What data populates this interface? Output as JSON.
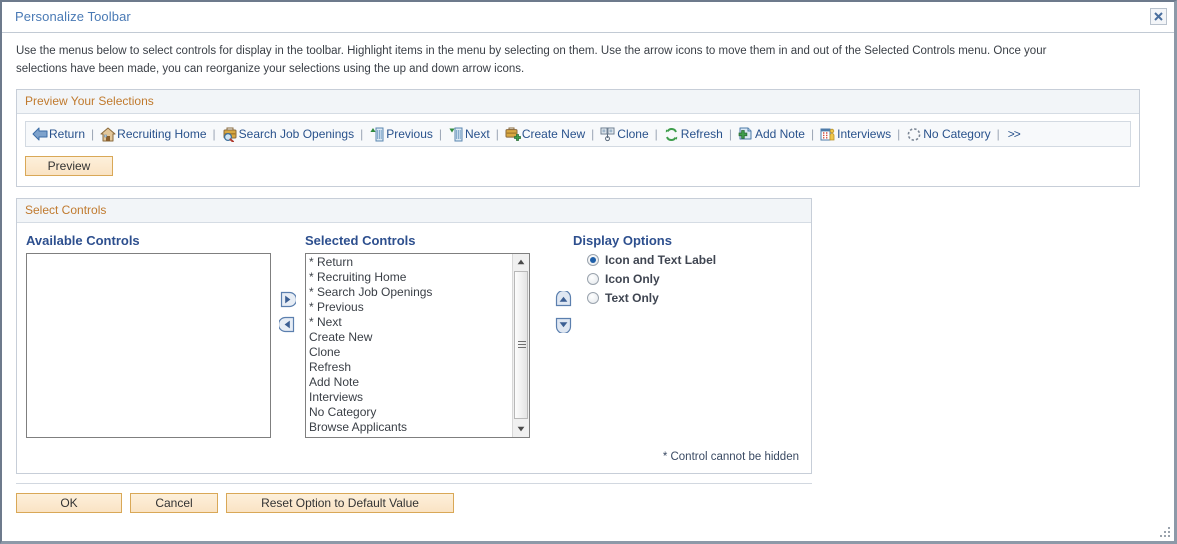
{
  "window": {
    "title": "Personalize Toolbar",
    "close_icon": "close-icon",
    "resize_grip_icon": "resize-grip-icon"
  },
  "instructions": "Use the menus below to select controls for display in the toolbar. Highlight items in the menu by selecting on them. Use the arrow icons to move them in and out of the Selected Controls menu. Once your selections have been made, you can reorganize your selections using the up and down arrow icons.",
  "preview_group": {
    "header": "Preview Your Selections",
    "separator": "|",
    "more_label": ">>",
    "toolbar_items": [
      {
        "label": "Return",
        "icon": "back-arrow-icon"
      },
      {
        "label": "Recruiting Home",
        "icon": "home-icon"
      },
      {
        "label": "Search Job Openings",
        "icon": "briefcase-search-icon"
      },
      {
        "label": "Previous",
        "icon": "previous-icon"
      },
      {
        "label": "Next",
        "icon": "next-icon"
      },
      {
        "label": "Create New",
        "icon": "create-new-icon"
      },
      {
        "label": "Clone",
        "icon": "clone-icon"
      },
      {
        "label": "Refresh",
        "icon": "refresh-icon"
      },
      {
        "label": "Add Note",
        "icon": "add-note-icon"
      },
      {
        "label": "Interviews",
        "icon": "interviews-icon"
      },
      {
        "label": "No Category",
        "icon": "no-category-icon"
      }
    ],
    "preview_button": "Preview"
  },
  "select_group": {
    "header": "Select Controls",
    "available": {
      "label": "Available Controls",
      "items": []
    },
    "selected": {
      "label": "Selected Controls",
      "items": [
        "* Return",
        "* Recruiting Home",
        "* Search Job Openings",
        "* Previous",
        "* Next",
        "Create New",
        "Clone",
        "Refresh",
        "Add Note",
        "Interviews",
        "No Category",
        "Browse Applicants"
      ]
    },
    "transfer": {
      "move_right_icon": "arrow-right-icon",
      "move_left_icon": "arrow-left-icon"
    },
    "reorder": {
      "move_up_icon": "arrow-up-icon",
      "move_down_icon": "arrow-down-icon"
    },
    "display_options": {
      "label": "Display Options",
      "selected": "Icon and Text Label",
      "options": [
        {
          "label": "Icon and Text Label",
          "checked": true
        },
        {
          "label": "Icon Only",
          "checked": false
        },
        {
          "label": "Text Only",
          "checked": false
        }
      ]
    },
    "note": "* Control cannot be hidden"
  },
  "footer": {
    "ok": "OK",
    "cancel": "Cancel",
    "reset": "Reset Option to Default Value"
  },
  "colors": {
    "title_blue": "#4a7ab5",
    "group_header_orange": "#c07a2e",
    "link_blue": "#29528c",
    "heading_blue": "#2d4f8e",
    "button_face": "#fae3c4",
    "button_border": "#d9a857",
    "radio_selected": "#1f5fa8"
  }
}
